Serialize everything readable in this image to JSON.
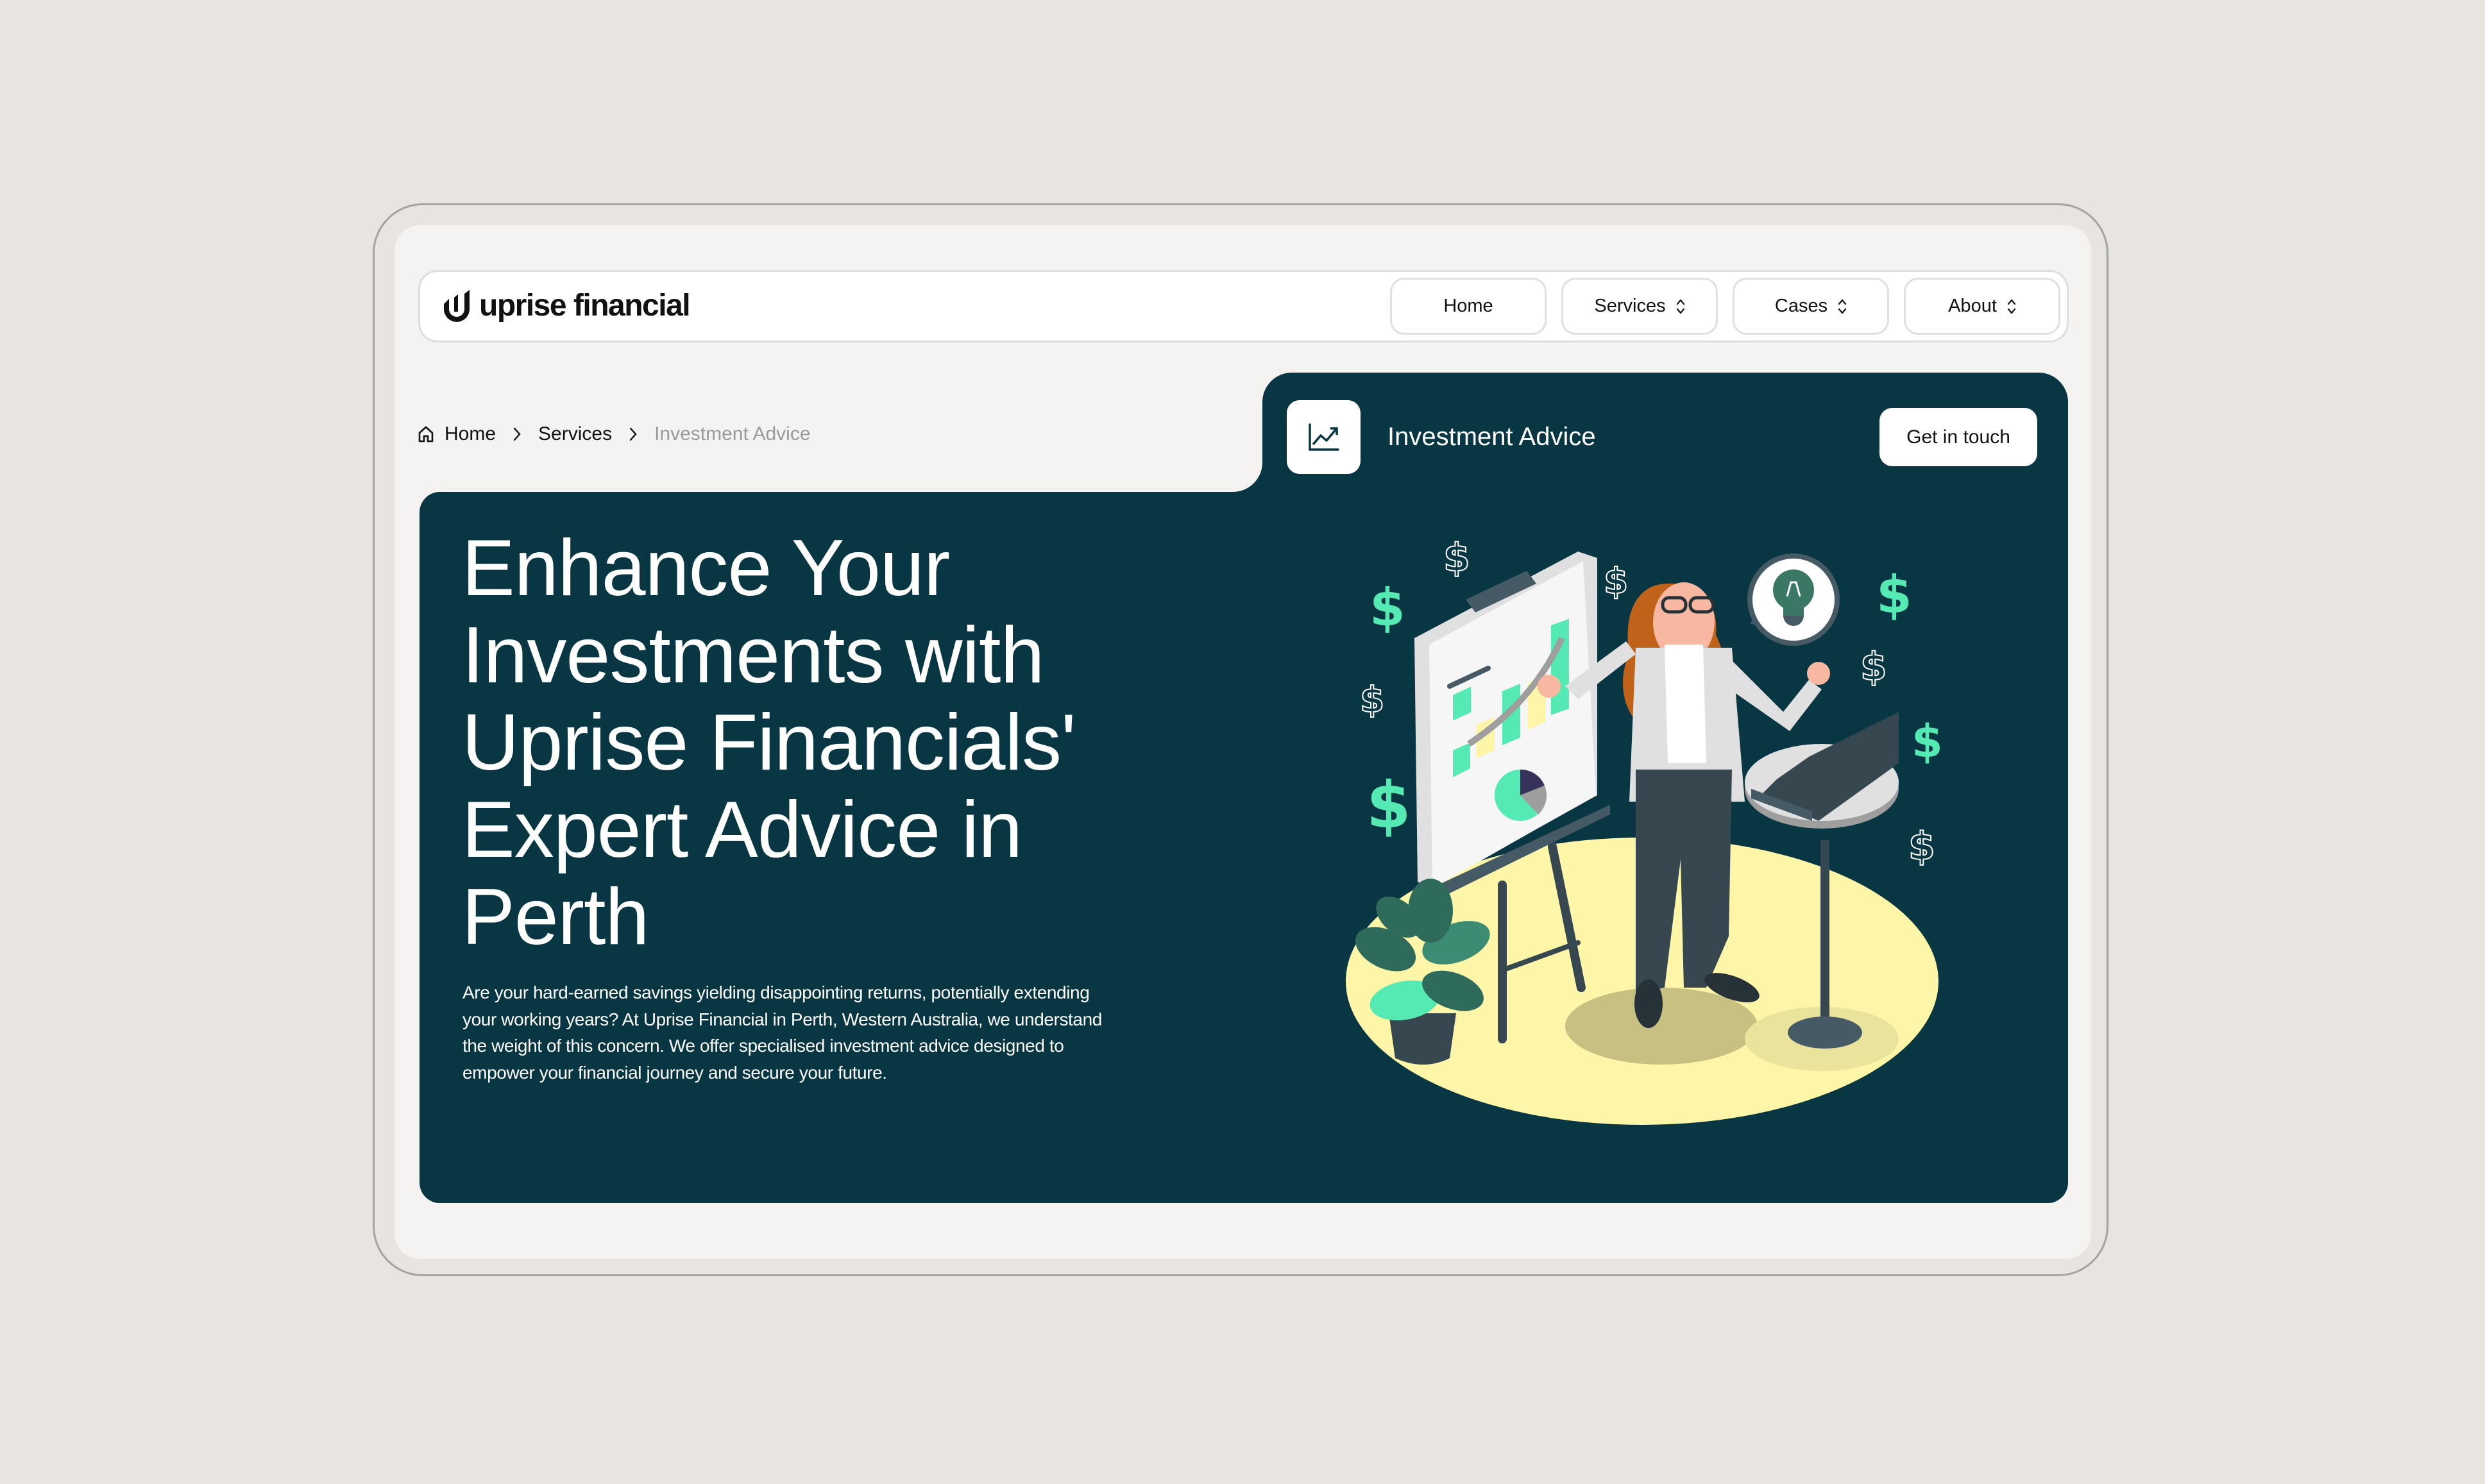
{
  "brand": {
    "name": "uprise financial",
    "logo_icon": "uprise-u-mark-icon"
  },
  "nav": {
    "items": [
      {
        "label": "Home",
        "has_dropdown": false
      },
      {
        "label": "Services",
        "has_dropdown": true
      },
      {
        "label": "Cases",
        "has_dropdown": true
      },
      {
        "label": "About",
        "has_dropdown": true
      }
    ],
    "dropdown_icon": "chevron-up-down-icon"
  },
  "breadcrumb": {
    "home_icon": "home-icon",
    "items": [
      {
        "label": "Home"
      },
      {
        "label": "Services"
      },
      {
        "label": "Investment Advice",
        "current": true
      }
    ],
    "separator_icon": "chevron-right-icon"
  },
  "service_tab": {
    "icon": "trending-up-chart-icon",
    "title": "Investment Advice",
    "cta_label": "Get in touch"
  },
  "hero": {
    "headline": "Enhance Your Investments with Uprise Financials' Expert Advice in Perth",
    "description": "Are your hard-earned savings yielding disappointing returns, potentially extending your working years? At Uprise Financial in Perth, Western Australia, we understand the weight of this concern. We offer specialised investment advice designed to empower your financial journey and secure your future.",
    "illustration": "woman-presenting-investment-chart-illustration"
  },
  "colors": {
    "page_bg": "#e8e5e0",
    "panel_bg": "#f4f3f1",
    "brand_dark": "#083642",
    "accent_green": "#55eab4",
    "highlight_yellow": "#fdf6a8",
    "muted_text": "#9a9a9a"
  }
}
